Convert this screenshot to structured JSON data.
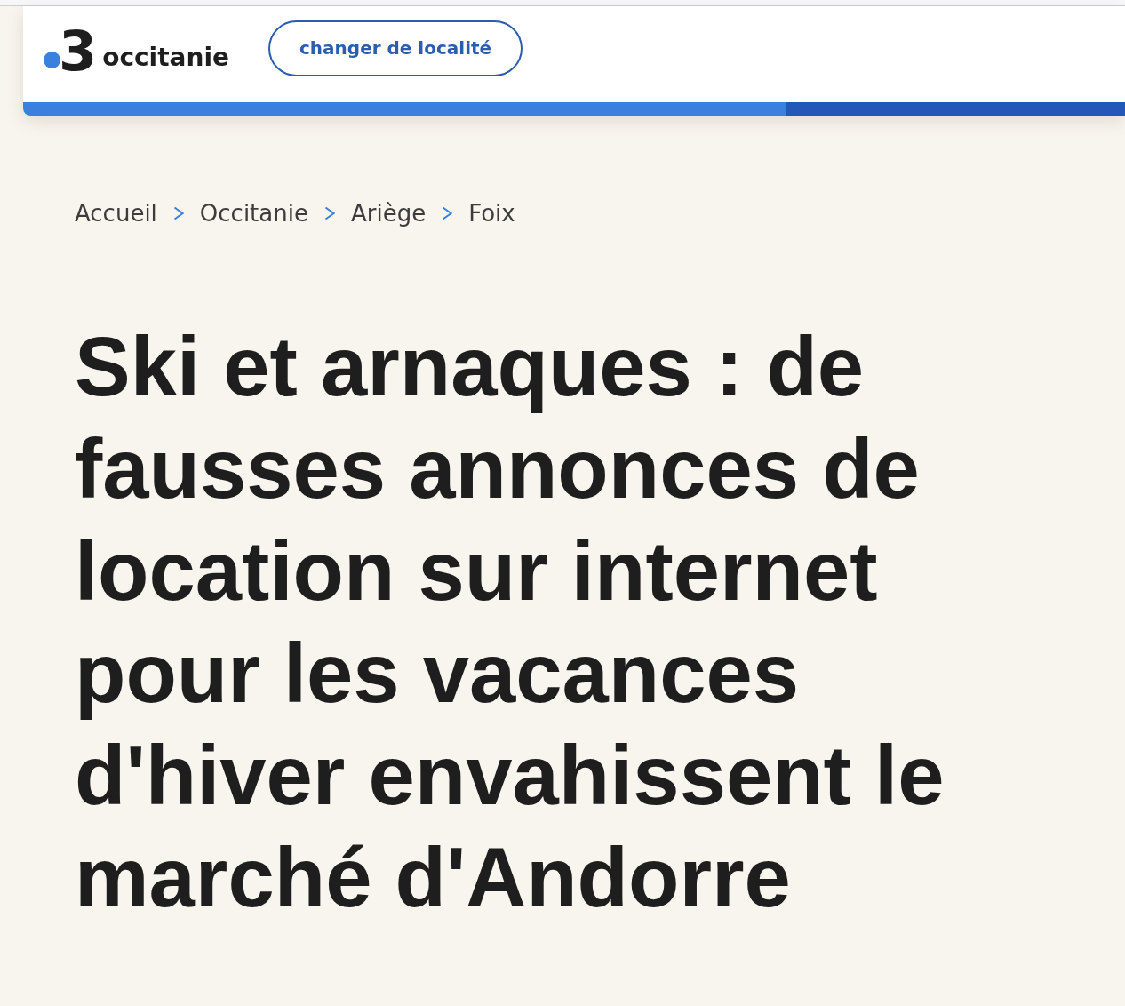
{
  "header": {
    "logo": {
      "number": "3",
      "name": "occitanie"
    },
    "location_button": "changer de localité"
  },
  "breadcrumb": [
    {
      "label": "Accueil"
    },
    {
      "label": "Occitanie"
    },
    {
      "label": "Ariège"
    },
    {
      "label": "Foix"
    }
  ],
  "article": {
    "title": "Ski et arnaques : de fausses annonces de location sur internet pour les vacances d'hiver envahissent le marché d'Andorre"
  }
}
